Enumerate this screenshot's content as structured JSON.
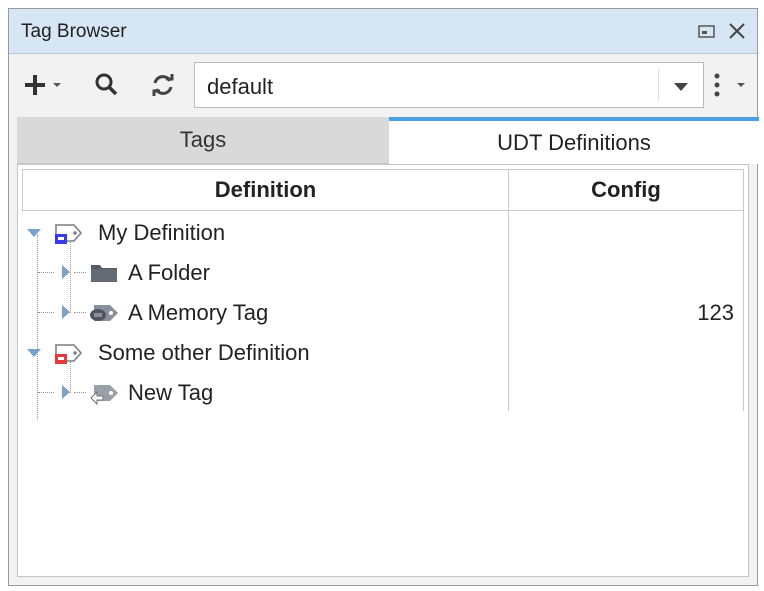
{
  "window": {
    "title": "Tag Browser",
    "restore_icon": "restore-window-icon",
    "close_icon": "close-icon"
  },
  "toolbar": {
    "add_icon": "plus-icon",
    "add_dropdown_icon": "chevron-down-icon",
    "search_icon": "search-icon",
    "refresh_icon": "refresh-icon",
    "provider_value": "default",
    "provider_dropdown_icon": "dropdown-arrow-icon",
    "menu_icon": "kebab-menu-icon",
    "menu_dropdown_icon": "chevron-down-icon"
  },
  "tabs": [
    {
      "label": "Tags",
      "active": false
    },
    {
      "label": "UDT Definitions",
      "active": true
    }
  ],
  "table": {
    "columns": [
      "Definition",
      "Config"
    ],
    "rows": [
      {
        "label": "My Definition",
        "config": "",
        "icon": "udt-definition-icon",
        "icon_color": "#3a3ae8",
        "expanded": true,
        "level": 0
      },
      {
        "label": "A Folder",
        "config": "",
        "icon": "folder-icon",
        "icon_color": "#555c66",
        "expanded": false,
        "level": 1
      },
      {
        "label": "A Memory Tag",
        "config": "123",
        "icon": "memory-tag-icon",
        "icon_color": "#666c75",
        "expanded": false,
        "level": 1
      },
      {
        "label": "Some other Definition",
        "config": "",
        "icon": "udt-definition-icon",
        "icon_color": "#e43b3b",
        "expanded": true,
        "level": 0
      },
      {
        "label": "New Tag",
        "config": "",
        "icon": "expression-tag-icon",
        "icon_color": "#8a9099",
        "expanded": false,
        "level": 1
      }
    ]
  },
  "colors": {
    "title_bar": "#d6e6f4",
    "active_tab_accent": "#4a9fe0",
    "tree_expander": "#7aa3c8"
  }
}
